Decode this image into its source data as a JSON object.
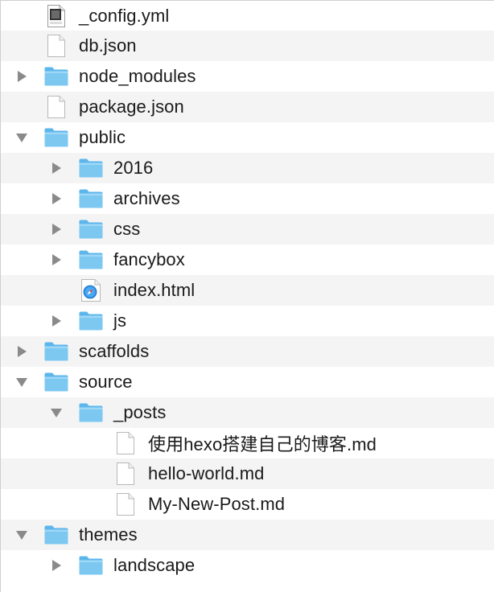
{
  "file_browser": {
    "icon_color": "#7cc8f1",
    "items": [
      {
        "name": "_config.yml",
        "depth": 0,
        "type": "yaml",
        "disclosure": "none"
      },
      {
        "name": "db.json",
        "depth": 0,
        "type": "document",
        "disclosure": "none"
      },
      {
        "name": "node_modules",
        "depth": 0,
        "type": "folder",
        "disclosure": "collapsed"
      },
      {
        "name": "package.json",
        "depth": 0,
        "type": "document",
        "disclosure": "none"
      },
      {
        "name": "public",
        "depth": 0,
        "type": "folder",
        "disclosure": "expanded"
      },
      {
        "name": "2016",
        "depth": 1,
        "type": "folder",
        "disclosure": "collapsed"
      },
      {
        "name": "archives",
        "depth": 1,
        "type": "folder",
        "disclosure": "collapsed"
      },
      {
        "name": "css",
        "depth": 1,
        "type": "folder",
        "disclosure": "collapsed"
      },
      {
        "name": "fancybox",
        "depth": 1,
        "type": "folder",
        "disclosure": "collapsed"
      },
      {
        "name": "index.html",
        "depth": 1,
        "type": "html",
        "disclosure": "none"
      },
      {
        "name": "js",
        "depth": 1,
        "type": "folder",
        "disclosure": "collapsed"
      },
      {
        "name": "scaffolds",
        "depth": 0,
        "type": "folder",
        "disclosure": "collapsed"
      },
      {
        "name": "source",
        "depth": 0,
        "type": "folder",
        "disclosure": "expanded"
      },
      {
        "name": "_posts",
        "depth": 1,
        "type": "folder",
        "disclosure": "expanded"
      },
      {
        "name": "使用hexo搭建自己的博客.md",
        "depth": 2,
        "type": "document",
        "disclosure": "none"
      },
      {
        "name": "hello-world.md",
        "depth": 2,
        "type": "document",
        "disclosure": "none"
      },
      {
        "name": "My-New-Post.md",
        "depth": 2,
        "type": "document",
        "disclosure": "none"
      },
      {
        "name": "themes",
        "depth": 0,
        "type": "folder",
        "disclosure": "expanded"
      },
      {
        "name": "landscape",
        "depth": 1,
        "type": "folder",
        "disclosure": "collapsed"
      }
    ]
  }
}
